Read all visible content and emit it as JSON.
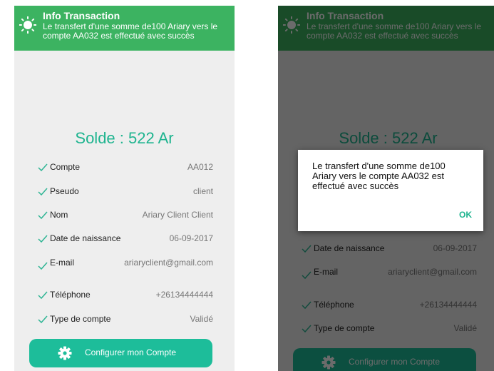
{
  "notification": {
    "title": "Info Transaction",
    "message": "Le transfert d'une somme de100 Ariary vers le compte AA032 est effectué  avec succès"
  },
  "balance": {
    "text": "Solde : 522 Ar"
  },
  "fields": [
    {
      "label": "Compte",
      "value": "AA012"
    },
    {
      "label": "Pseudo",
      "value": "client"
    },
    {
      "label": "Nom",
      "value": "Ariary Client Client"
    },
    {
      "label": "Date de naissance",
      "value": "06-09-2017"
    },
    {
      "label": "E-mail",
      "value": "ariaryclient@gmail.com"
    },
    {
      "label": "Téléphone",
      "value": "+26134444444"
    },
    {
      "label": "Type de compte",
      "value": "Validé"
    }
  ],
  "config_button": {
    "label": "Configurer mon Compte"
  },
  "dialog": {
    "message": "Le transfert d'une somme de100 Ariary vers le compte AA032 est effectué  avec succès",
    "ok_label": "OK"
  },
  "colors": {
    "notification_bg": "#3cb361",
    "accent": "#1eb48f",
    "button_bg": "#1dbd9a",
    "screen_bg": "#eeeeee"
  },
  "icons": {
    "notification": "sun-icon",
    "field": "check-icon",
    "button": "gear-icon"
  }
}
